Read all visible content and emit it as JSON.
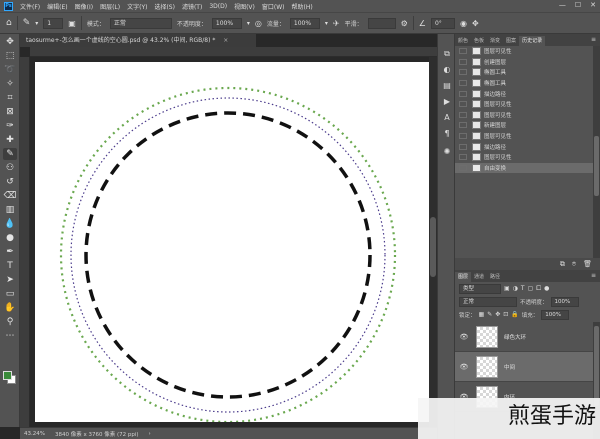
{
  "app": {
    "logo": "Ps",
    "menu": [
      "文件(F)",
      "编辑(E)",
      "图像(I)",
      "图层(L)",
      "文字(Y)",
      "选择(S)",
      "滤镜(T)",
      "3D(D)",
      "视图(V)",
      "窗口(W)",
      "帮助(H)"
    ],
    "window_controls": [
      "—",
      "☐",
      "✕"
    ]
  },
  "options_bar": {
    "brush_size": "1",
    "mode_label": "模式：",
    "mode_value": "正常",
    "opacity_label": "不透明度：",
    "opacity_value": "100%",
    "flow_label": "流量：",
    "flow_value": "100%",
    "smoothing_label": "平滑：",
    "smoothing_value": "",
    "angle_value": "0°"
  },
  "document": {
    "tab_title": "taosurme+-怎么画一个虚线的空心圆.psd @ 43.2% (中间, RGB/8) *",
    "close": "×",
    "circle_colors": {
      "outer": "#6aa84f",
      "middle": "#4b3c8c",
      "inner": "#111111"
    }
  },
  "status_bar": {
    "zoom": "43.24%",
    "info": "3840 像素 x 3760 像素 (72 ppi)"
  },
  "history_panel": {
    "tabs": [
      "颜色",
      "色板",
      "渐变",
      "图案",
      "历史记录"
    ],
    "active_tab": "历史记录",
    "items": [
      "图层可见性",
      "创建图层",
      "椭圆工具",
      "椭圆工具",
      "描边路径",
      "图层可见性",
      "图层可见性",
      "新建图层",
      "图层可见性",
      "描边路径",
      "图层可见性",
      "自由变换"
    ],
    "selected_index": 11
  },
  "layers_panel": {
    "tabs": [
      "图层",
      "通道",
      "路径"
    ],
    "active_tab": "图层",
    "filter_kind": "类型",
    "blend_mode": "正常",
    "opacity_label": "不透明度：",
    "opacity_value": "100%",
    "lock_label": "锁定：",
    "fill_label": "填充：",
    "fill_value": "100%",
    "layers": [
      {
        "name": "绿色大环",
        "selected": false
      },
      {
        "name": "中间",
        "selected": true
      },
      {
        "name": "内环",
        "selected": false
      }
    ]
  },
  "watermark": {
    "text": "煎蛋手游"
  }
}
